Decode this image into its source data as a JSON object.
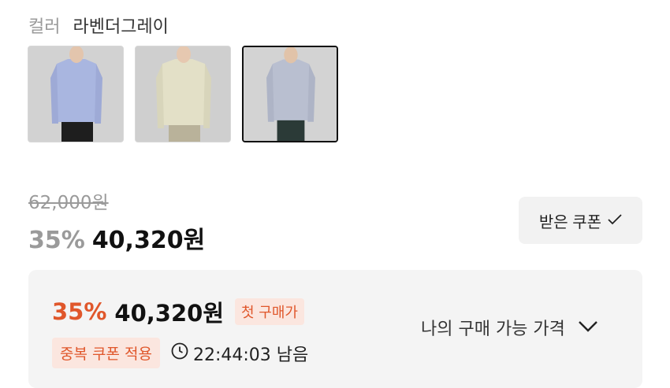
{
  "color": {
    "label": "컬러",
    "value": "라벤더그레이"
  },
  "swatches": [
    {
      "name": "blue-shirt",
      "shirt": "#a9b6e0",
      "pants": "#1e1e1e",
      "bg": "#d2d2d2",
      "skin": "#e3c5ad"
    },
    {
      "name": "cream-shirt",
      "shirt": "#e3e0c7",
      "pants": "#b9b29a",
      "bg": "#cfcfcf",
      "skin": "#e6c8b0"
    },
    {
      "name": "lavender-grey-shirt",
      "shirt": "#b9bfd0",
      "pants": "#2b3a37",
      "bg": "#d3d3d3",
      "skin": "#e1c3a9"
    }
  ],
  "price": {
    "original": "62,000원",
    "discount": "35%",
    "sale": "40,320원"
  },
  "coupon_button": {
    "label": "받은 쿠폰",
    "icon": "check-icon"
  },
  "panel": {
    "discount": "35%",
    "price": "40,320원",
    "first_purchase_tag": "첫 구매가",
    "duplicate_coupon_tag": "중복 쿠폰 적용",
    "timer_icon": "clock-icon",
    "timer": "22:44:03 남음",
    "my_price_label": "나의 구매 가능 가격",
    "my_price_icon": "chevron-down-icon"
  },
  "colors": {
    "accent": "#e0572b",
    "accent_bg": "#fbe6df",
    "muted": "#9a9a9a"
  }
}
